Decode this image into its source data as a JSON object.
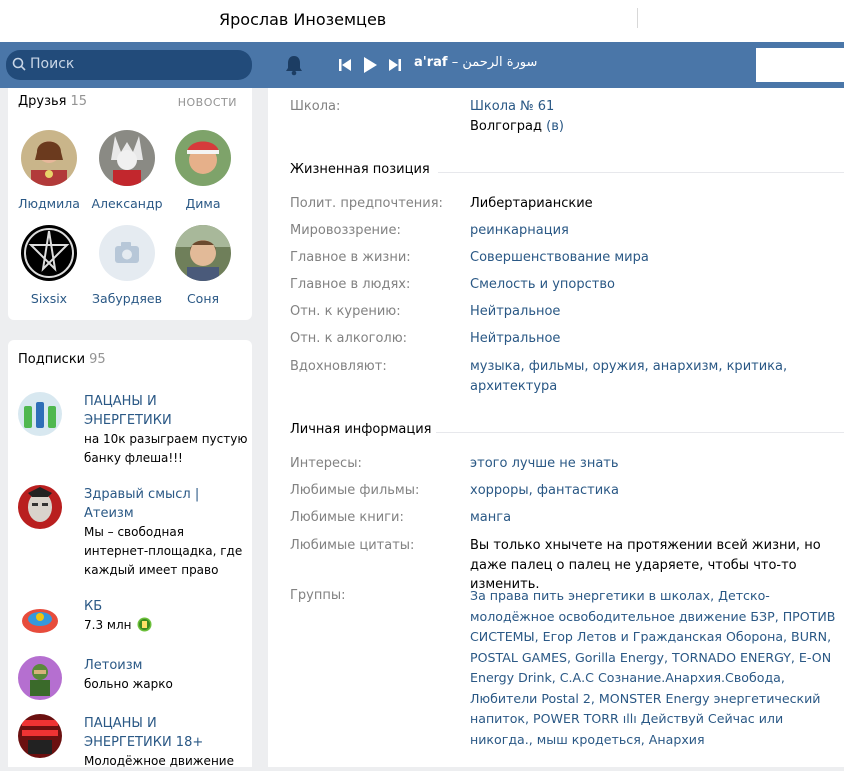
{
  "window": {
    "user_name": "Ярослав Иноземцев"
  },
  "topbar": {
    "search_placeholder": "Поиск",
    "player": {
      "artist": "a'raf",
      "separator": "–",
      "track": "سورة الرحمن"
    }
  },
  "friends": {
    "title": "Друзья",
    "count": "15",
    "news_link": "НОВОСТИ",
    "items": [
      {
        "name": "Людмила"
      },
      {
        "name": "Александр"
      },
      {
        "name": "Дима"
      },
      {
        "name": "Sixsix"
      },
      {
        "name": "Забурдяев"
      },
      {
        "name": "Соня"
      }
    ]
  },
  "subscriptions": {
    "title": "Подписки",
    "count": "95",
    "items": [
      {
        "title": "ПАЦАНЫ И ЭНЕРГЕТИКИ",
        "desc": "на 10к разыграем пустую банку флеша!!!"
      },
      {
        "title": "Здравый смысл | Атеизм",
        "desc": "Мы – свободная интернет-площадка, где каждый имеет право"
      },
      {
        "title": "КБ",
        "desc": "7.3 млн"
      },
      {
        "title": "Летоизм",
        "desc": "больно жарко"
      },
      {
        "title": "ПАЦАНЫ И ЭНЕРГЕТИКИ 18+",
        "desc": "Молодёжное движение"
      }
    ]
  },
  "profile": {
    "school_label": "Школа:",
    "school_value": "Школа № 61",
    "school_city": "Волгоград",
    "school_suffix": " (в)",
    "life_position_title": "Жизненная позиция",
    "life_position": [
      {
        "label": "Полит. предпочтения:",
        "value": "Либертарианские"
      },
      {
        "label": "Мировоззрение:",
        "value": "реинкарнация"
      },
      {
        "label": "Главное в жизни:",
        "value": "Совершенствование мира"
      },
      {
        "label": "Главное в людях:",
        "value": "Смелость и упорство"
      },
      {
        "label": "Отн. к курению:",
        "value": "Нейтральное"
      },
      {
        "label": "Отн. к алкоголю:",
        "value": "Нейтральное"
      },
      {
        "label": "Вдохновляют:",
        "value": "музыка, фильмы, оружия, анархизм, критика, архитектура"
      }
    ],
    "personal_title": "Личная информация",
    "personal": [
      {
        "label": "Интересы:",
        "value": "этого лучше не знать"
      },
      {
        "label": "Любимые фильмы:",
        "value": "хорроры, фантастика"
      },
      {
        "label": "Любимые книги:",
        "value": "манга"
      },
      {
        "label": "Любимые цитаты:",
        "value": "Вы только хнычете на протяжении всей жизни, но даже палец о палец не ударяете, чтобы что-то изменить."
      },
      {
        "label": "Группы:",
        "value": "За права пить энергетики в школах, Детско-молодёжное освободительное движение БЗР, ПРОТИВ СИСТЕМЫ, Егор Летов и Гражданская Оборона, BURN, POSTAL GAMES, Gorilla Energy, TORNADO ENERGY, E-ON Energy Drink, С.А.С Сознание.Анархия.Свобода, Любители Postal 2, MONSTER Energy энергетический напиток, POWER TORR ıllı Действуй Сейчас или никогда., мыш кродеться, Анархия"
      }
    ]
  },
  "colors": {
    "header": "#4a76a8",
    "link": "#2a5885",
    "label": "#828282",
    "bg": "#edeef0"
  }
}
